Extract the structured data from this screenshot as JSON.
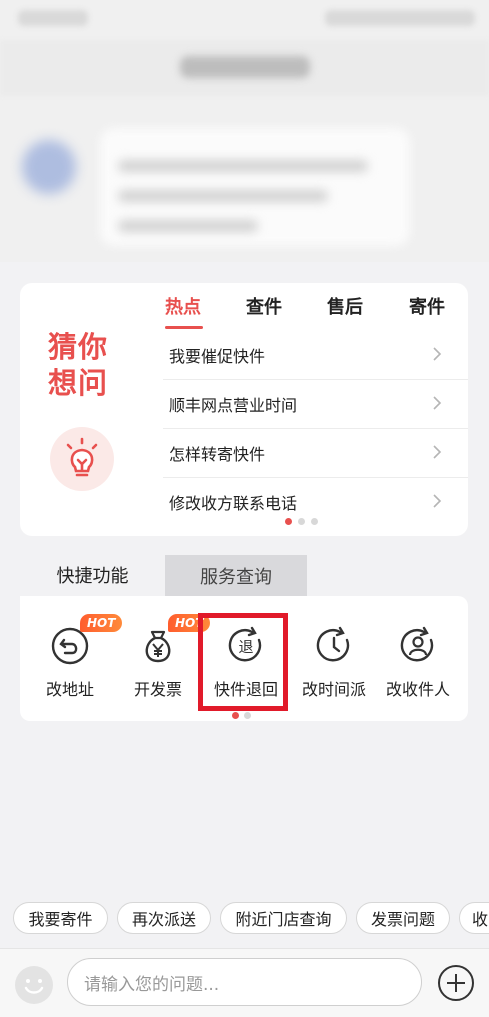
{
  "guess": {
    "title": "猜你想问",
    "tabs": [
      {
        "label": "热点",
        "active": true
      },
      {
        "label": "查件",
        "active": false
      },
      {
        "label": "售后",
        "active": false
      },
      {
        "label": "寄件",
        "active": false
      }
    ],
    "questions": [
      "我要催促快件",
      "顺丰网点营业时间",
      "怎样转寄快件",
      "修改收方联系电话"
    ],
    "page_index": 1,
    "page_count": 3
  },
  "quick": {
    "tabs": [
      {
        "label": "快捷功能",
        "active": true
      },
      {
        "label": "服务查询",
        "active": false
      }
    ],
    "items": [
      {
        "label": "改地址",
        "icon": "undo-arrow-icon",
        "hot": "HOT"
      },
      {
        "label": "开发票",
        "icon": "yuan-bag-icon",
        "hot": "HOT"
      },
      {
        "label": "快件退回",
        "icon": "return-icon",
        "highlighted": true
      },
      {
        "label": "改时间派",
        "icon": "clock-icon"
      },
      {
        "label": "改收件人",
        "icon": "person-icon"
      }
    ],
    "page_index": 1,
    "page_count": 2
  },
  "chips": [
    "我要寄件",
    "再次派送",
    "附近门店查询",
    "发票问题",
    "收"
  ],
  "input": {
    "placeholder": "请输入您的问题..."
  },
  "colors": {
    "accent": "#e8504e",
    "highlight_box": "#e11a2a",
    "hot_badge": "#ff5d2e"
  }
}
